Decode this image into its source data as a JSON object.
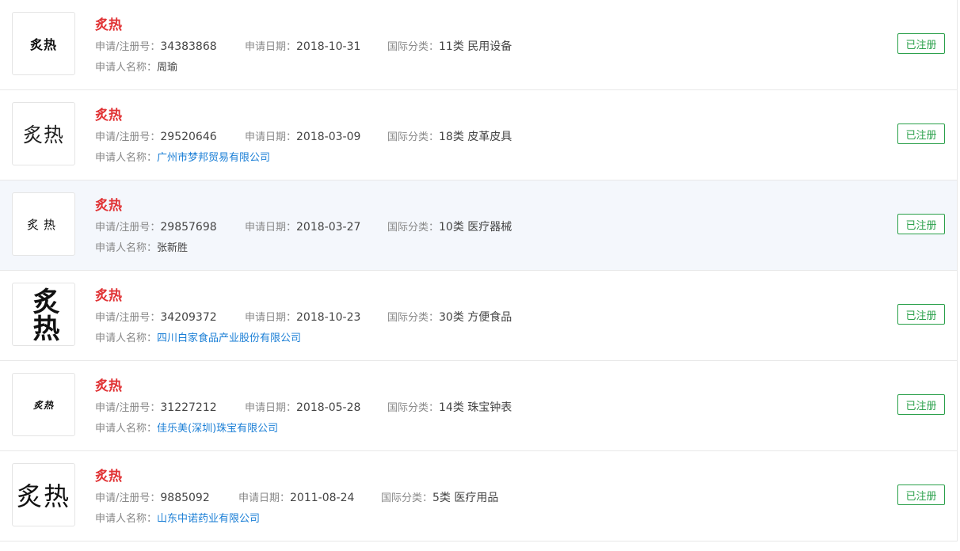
{
  "labels": {
    "reg_no": "申请/注册号：",
    "apply_date": "申请日期：",
    "intl_class": "国际分类：",
    "applicant": "申请人名称："
  },
  "results": [
    {
      "logo_text": "炙热",
      "title": "炙热",
      "reg_no": "34383868",
      "date": "2018-10-31",
      "class": "11类 民用设备",
      "applicant": "周瑜",
      "applicant_is_link": false,
      "status": "已注册"
    },
    {
      "logo_text": "炙热",
      "title": "炙热",
      "reg_no": "29520646",
      "date": "2018-03-09",
      "class": "18类 皮革皮具",
      "applicant": "广州市梦邦贸易有限公司",
      "applicant_is_link": true,
      "status": "已注册"
    },
    {
      "logo_text": "炙热",
      "title": "炙热",
      "reg_no": "29857698",
      "date": "2018-03-27",
      "class": "10类 医疗器械",
      "applicant": "张新胜",
      "applicant_is_link": false,
      "status": "已注册"
    },
    {
      "logo_text": "炙热",
      "title": "炙热",
      "reg_no": "34209372",
      "date": "2018-10-23",
      "class": "30类 方便食品",
      "applicant": "四川白家食品产业股份有限公司",
      "applicant_is_link": true,
      "status": "已注册"
    },
    {
      "logo_text": "炙热",
      "title": "炙热",
      "reg_no": "31227212",
      "date": "2018-05-28",
      "class": "14类 珠宝钟表",
      "applicant": "佳乐美(深圳)珠宝有限公司",
      "applicant_is_link": true,
      "status": "已注册"
    },
    {
      "logo_text": "炙热",
      "title": "炙热",
      "reg_no": "9885092",
      "date": "2011-08-24",
      "class": "5类 医疗用品",
      "applicant": "山东中诺药业有限公司",
      "applicant_is_link": true,
      "status": "已注册"
    }
  ]
}
